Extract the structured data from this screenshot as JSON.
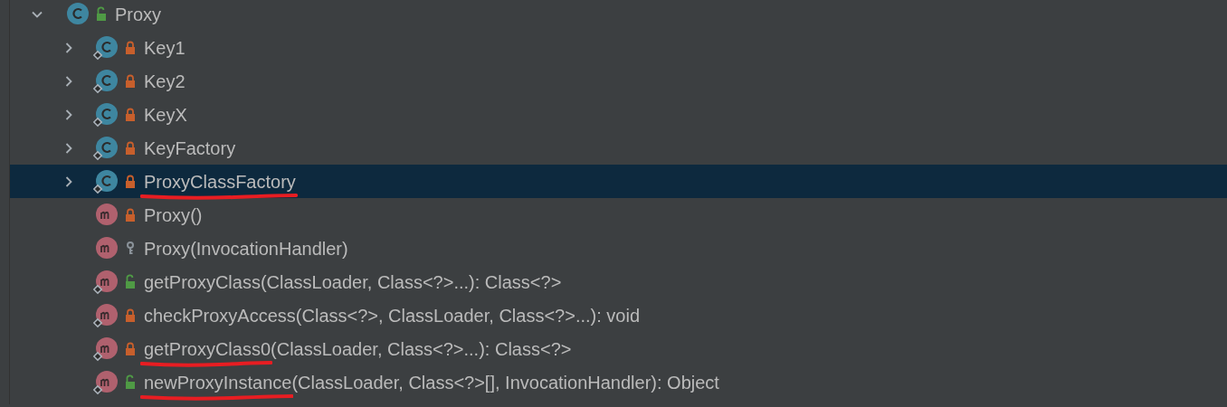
{
  "tree": {
    "name": "Proxy",
    "kind": "class",
    "access": {
      "kind": "public"
    },
    "static": false,
    "expanded": true,
    "selected": false,
    "underlined": false,
    "children": [
      {
        "name": "Key1",
        "kind": "class",
        "access": {
          "kind": "private"
        },
        "static": true,
        "expanded": false,
        "selected": false,
        "underlined": false
      },
      {
        "name": "Key2",
        "kind": "class",
        "access": {
          "kind": "private"
        },
        "static": true,
        "expanded": false,
        "selected": false,
        "underlined": false
      },
      {
        "name": "KeyX",
        "kind": "class",
        "access": {
          "kind": "private"
        },
        "static": true,
        "expanded": false,
        "selected": false,
        "underlined": false
      },
      {
        "name": "KeyFactory",
        "kind": "class",
        "access": {
          "kind": "private"
        },
        "static": true,
        "expanded": false,
        "selected": false,
        "underlined": false
      },
      {
        "name": "ProxyClassFactory",
        "kind": "class",
        "access": {
          "kind": "private"
        },
        "static": true,
        "expanded": false,
        "selected": true,
        "underlined": true
      },
      {
        "name": "Proxy",
        "signature": "()",
        "kind": "method",
        "access": {
          "kind": "private"
        },
        "static": false,
        "selected": false,
        "underlined": false
      },
      {
        "name": "Proxy",
        "signature": "(InvocationHandler)",
        "kind": "method",
        "access": {
          "kind": "package"
        },
        "static": false,
        "selected": false,
        "underlined": false
      },
      {
        "name": "getProxyClass",
        "signature": "(ClassLoader, Class<?>...): Class<?>",
        "kind": "method",
        "access": {
          "kind": "public"
        },
        "static": true,
        "selected": false,
        "underlined": false
      },
      {
        "name": "checkProxyAccess",
        "signature": "(Class<?>, ClassLoader, Class<?>...): void",
        "kind": "method",
        "access": {
          "kind": "private"
        },
        "static": true,
        "selected": false,
        "underlined": false
      },
      {
        "name": "getProxyClass0",
        "signature": "(ClassLoader, Class<?>...): Class<?>",
        "kind": "method",
        "access": {
          "kind": "private"
        },
        "static": true,
        "selected": false,
        "underlined": true
      },
      {
        "name": "newProxyInstance",
        "signature": "(ClassLoader, Class<?>[], InvocationHandler): Object",
        "kind": "method",
        "access": {
          "kind": "public"
        },
        "static": true,
        "selected": false,
        "underlined": true
      }
    ]
  }
}
